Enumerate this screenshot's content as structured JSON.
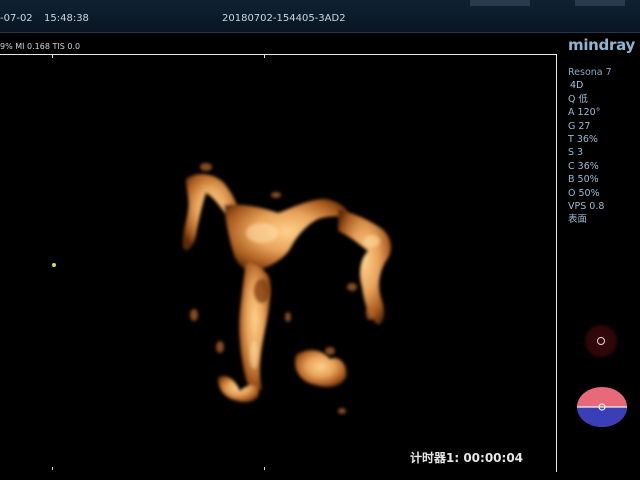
{
  "header": {
    "date": "-07-02",
    "time": "15:48:38",
    "exam_id": "20180702-154405-3AD2"
  },
  "status_line": "9%  MI 0.168 TIS 0.0",
  "brand": "mindray",
  "panel": {
    "model": "Resona 7",
    "mode": "4D",
    "params": [
      "Q 低",
      "A 120°",
      "G 27",
      "T 36%",
      "S 3",
      "C 36%",
      "B 50%",
      "O 50%",
      "VPS 0.8",
      "表面"
    ]
  },
  "timer": "计时器1: 00:00:04",
  "colors": {
    "rendering": "#e8a25a",
    "panel_text": "#9cb9d3",
    "brand": "#8fb5d3",
    "header_bg": "#0f2232"
  }
}
